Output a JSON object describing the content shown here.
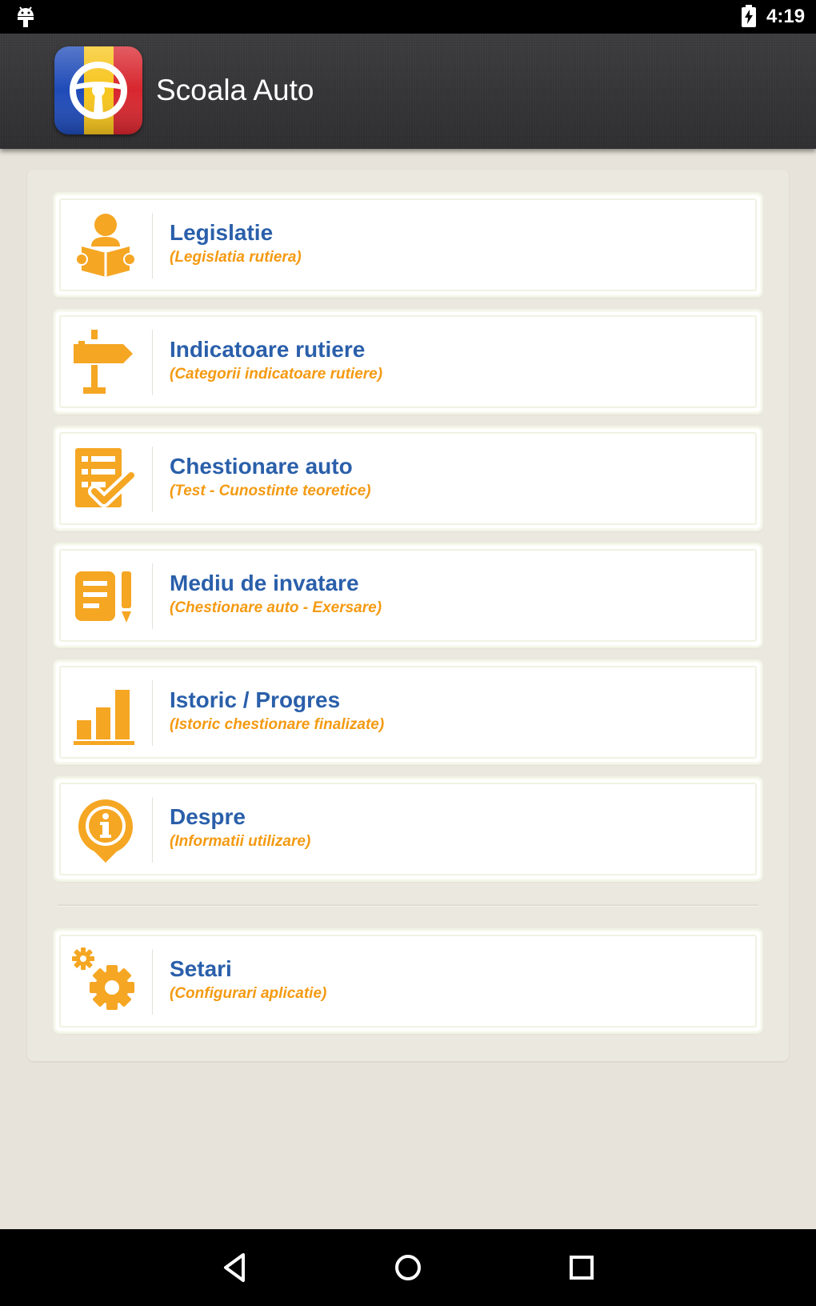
{
  "status_bar": {
    "time": "4:19",
    "icons": [
      "android-debug-icon",
      "battery-charging-icon"
    ]
  },
  "action_bar": {
    "title": "Scoala Auto",
    "logo_icon": "steering-wheel-icon"
  },
  "menu": {
    "items": [
      {
        "title": "Legislatie",
        "subtitle": "(Legislatia rutiera)",
        "icon": "person-reading-icon"
      },
      {
        "title": "Indicatoare rutiere",
        "subtitle": "(Categorii indicatoare rutiere)",
        "icon": "signpost-icon"
      },
      {
        "title": "Chestionare auto",
        "subtitle": "(Test - Cunostinte teoretice)",
        "icon": "checklist-icon"
      },
      {
        "title": "Mediu de invatare",
        "subtitle": "(Chestionare auto - Exersare)",
        "icon": "notes-pencil-icon"
      },
      {
        "title": "Istoric / Progres",
        "subtitle": "(Istoric chestionare finalizate)",
        "icon": "bar-chart-icon"
      },
      {
        "title": "Despre",
        "subtitle": "(Informatii utilizare)",
        "icon": "info-icon"
      }
    ],
    "settings": {
      "title": "Setari",
      "subtitle": "(Configurari aplicatie)",
      "icon": "gears-icon"
    }
  },
  "nav_bar": {
    "buttons": [
      "back-icon",
      "home-icon",
      "recents-icon"
    ]
  },
  "colors": {
    "accent_orange": "#f5a623",
    "title_blue": "#2a5faa",
    "subtitle_orange": "#f49a12",
    "action_bar": "#353537",
    "background": "#e7e3da"
  }
}
